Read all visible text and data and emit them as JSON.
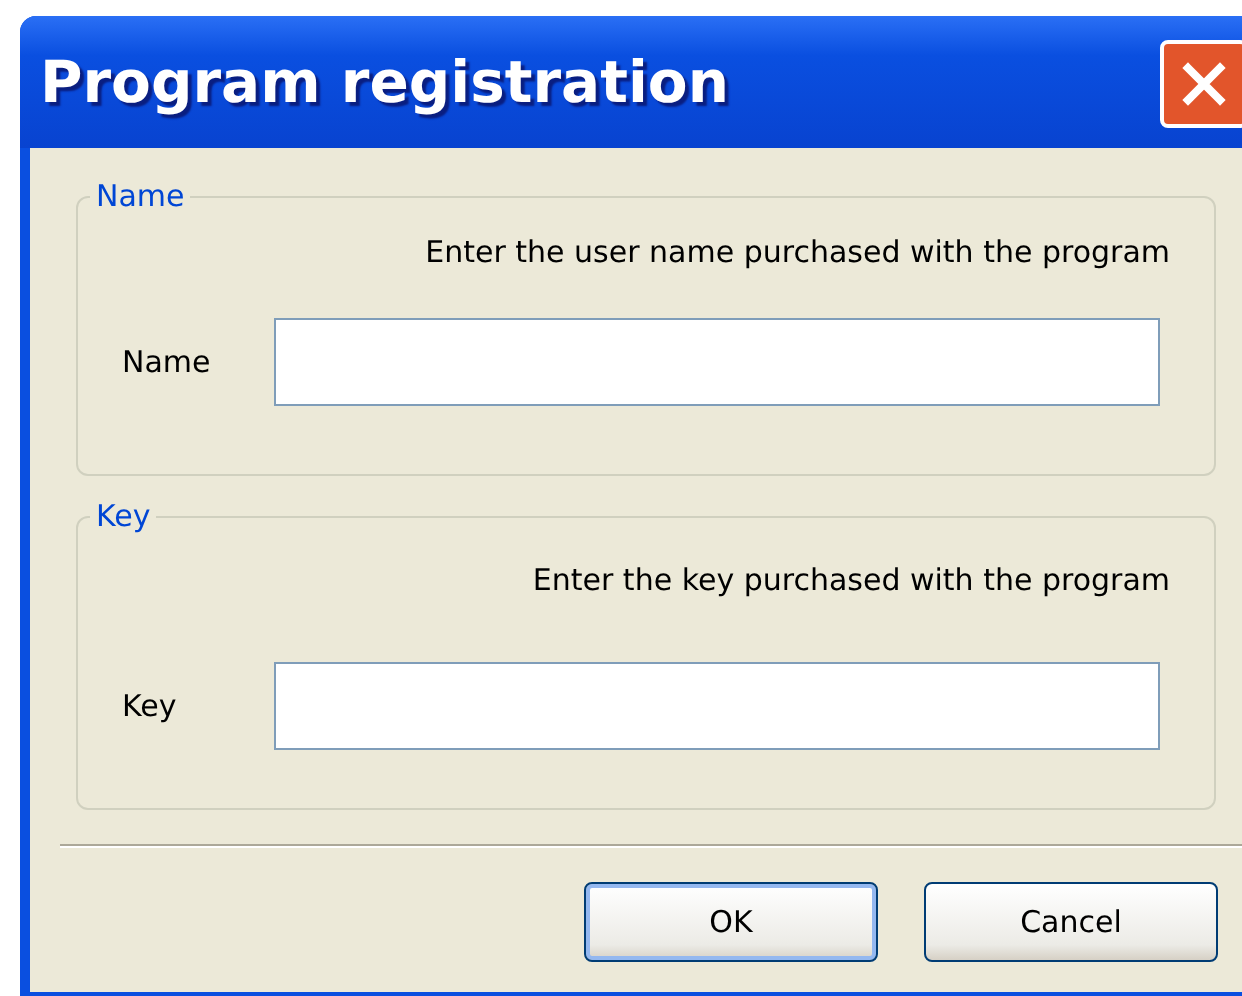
{
  "window": {
    "title": "Program registration"
  },
  "groups": [
    {
      "legend": "Name",
      "hint": "Enter the user name purchased with the program",
      "label": "Name"
    },
    {
      "legend": "Key",
      "hint": "Enter the key purchased with the program",
      "label": "Key"
    }
  ],
  "buttons": [
    {
      "label": "OK",
      "default": true
    },
    {
      "label": "Cancel",
      "default": false
    }
  ]
}
